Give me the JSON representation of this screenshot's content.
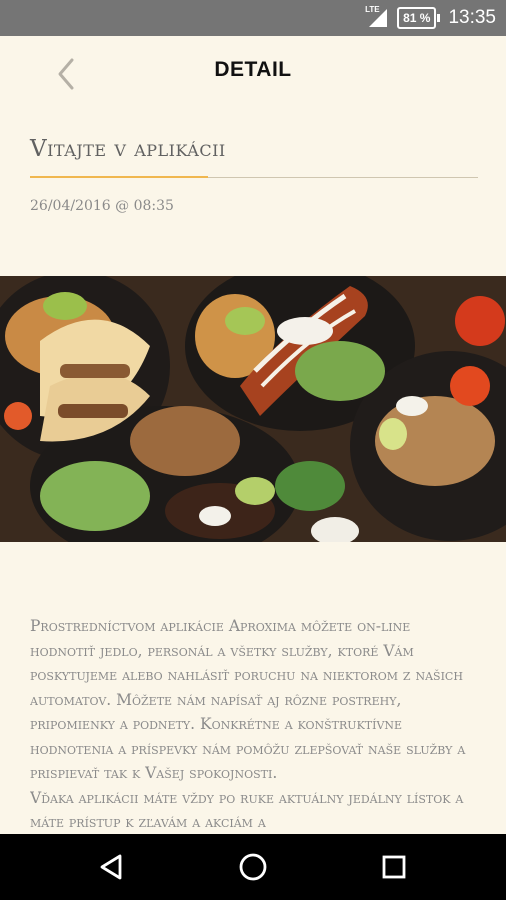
{
  "status_bar": {
    "network_label": "LTE",
    "battery_label": "81 %",
    "time": "13:35",
    "icons": [
      "signal-icon",
      "battery-icon"
    ]
  },
  "toolbar": {
    "title": "DETAIL",
    "back_icon": "chevron-left-icon"
  },
  "article": {
    "heading": "Vitajte v aplikácii",
    "date": "26/04/2016 @ 08:35",
    "image_alt": "food-photo",
    "paragraph_1": "Prostredníctvom aplikácie Aproxima môžete on-line hodnotiť jedlo, personál a všetky služby, ktoré Vám poskytujeme alebo nahlásiť poruchu na niektorom z našich automatov. Môžete nám napísať aj rôzne postrehy, pripomienky a podnety. Konkrétne a konštruktívne hodnotenia a príspevky nám pomôžu zlepšovať naše služby a prispievať tak k Vašej spokojnosti.",
    "paragraph_2": "Vďaka aplikácii máte vždy po ruke aktuálny jedálny lístok a máte prístup k zľavám a akciám a"
  },
  "nav_bar": {
    "icons": [
      "back-triangle-icon",
      "home-circle-icon",
      "recents-square-icon"
    ]
  },
  "colors": {
    "background": "#fbf6e9",
    "accent": "#f0b74f",
    "status_bar": "#757575",
    "nav_bar": "#000000"
  }
}
